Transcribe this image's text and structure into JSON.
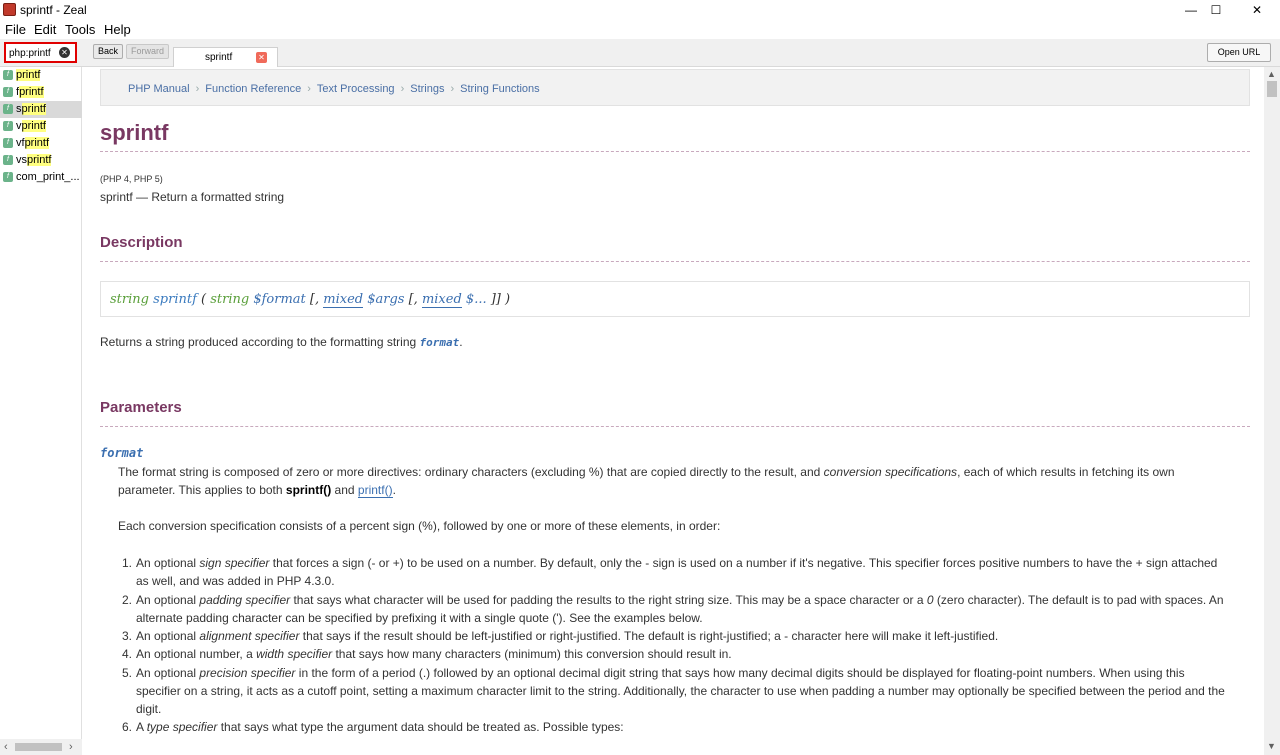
{
  "window": {
    "title": "sprintf - Zeal",
    "minimize": "—",
    "maximize": "☐",
    "close": "✕"
  },
  "menu": {
    "items": [
      "File",
      "Edit",
      "Tools",
      "Help"
    ]
  },
  "toolbar": {
    "search_value": "php:printf",
    "back_label": "Back",
    "forward_label": "Forward",
    "tab_label": "sprintf",
    "open_url_label": "Open URL"
  },
  "sidebar": {
    "results": [
      {
        "highlight": "printf",
        "rest": "",
        "selected": false
      },
      {
        "highlight": "f",
        "rest": "printf",
        "selected": false,
        "swap": true
      },
      {
        "highlight": "s",
        "rest": "printf",
        "selected": true,
        "swap": true
      },
      {
        "highlight": "v",
        "rest": "printf",
        "selected": false,
        "swap": true
      },
      {
        "highlight": "vf",
        "rest": "printf",
        "selected": false,
        "swap": true
      },
      {
        "highlight": "vs",
        "rest": "printf",
        "selected": false,
        "swap": true
      },
      {
        "highlight": "",
        "rest": "com_print_...",
        "selected": false
      }
    ]
  },
  "doc": {
    "breadcrumbs": [
      "PHP Manual",
      "Function Reference",
      "Text Processing",
      "Strings",
      "String Functions"
    ],
    "title": "sprintf",
    "versions": "(PHP 4, PHP 5)",
    "refpurpose": "sprintf — Return a formatted string",
    "description_heading": "Description",
    "synopsis": {
      "type": "string",
      "name": "sprintf",
      "open": " ( ",
      "p1_type": "string",
      "p1_name": "$format",
      "p2_pre": " [, ",
      "p2_type": "mixed",
      "p2_name": "$args",
      "p3_pre": " [, ",
      "p3_type": "mixed",
      "p3_name": "$...",
      "close": " ]] )"
    },
    "returns_text": "Returns a string produced according to the formatting string ",
    "returns_param": "format",
    "returns_end": ".",
    "parameters_heading": "Parameters",
    "param_name": "format",
    "param_desc_1": "The format string is composed of zero or more directives: ordinary characters (excluding %) that are copied directly to the result, and ",
    "param_desc_1_em": "conversion specifications",
    "param_desc_1b": ", each of which results in fetching its own parameter. This applies to both ",
    "param_desc_1_bold": "sprintf()",
    "param_desc_1_and": " and ",
    "param_desc_1_link": "printf()",
    "param_desc_1_end": ".",
    "param_desc_2": "Each conversion specification consists of a percent sign (%), followed by one or more of these elements, in order:",
    "list": [
      {
        "num": "1.",
        "pre": "An optional ",
        "em": "sign specifier",
        "post": " that forces a sign (- or +) to be used on a number. By default, only the - sign is used on a number if it's negative. This specifier forces positive numbers to have the + sign attached as well, and was added in PHP 4.3.0."
      },
      {
        "num": "2.",
        "pre": "An optional ",
        "em": "padding specifier",
        "post": " that says what character will be used for padding the results to the right string size. This may be a space character or a ",
        "em2": "0",
        "post2": " (zero character). The default is to pad with spaces. An alternate padding character can be specified by prefixing it with a single quote ('). See the examples below."
      },
      {
        "num": "3.",
        "pre": "An optional ",
        "em": "alignment specifier",
        "post": " that says if the result should be left-justified or right-justified. The default is right-justified; a - character here will make it left-justified."
      },
      {
        "num": "4.",
        "pre": "An optional number, a ",
        "em": "width specifier",
        "post": " that says how many characters (minimum) this conversion should result in."
      },
      {
        "num": "5.",
        "pre": "An optional ",
        "em": "precision specifier",
        "post": " in the form of a period (.) followed by an optional decimal digit string that says how many decimal digits should be displayed for floating-point numbers. When using this specifier on a string, it acts as a cutoff point, setting a maximum character limit to the string. Additionally, the character to use when padding a number may optionally be specified between the period and the digit."
      },
      {
        "num": "6.",
        "pre": "A ",
        "em": "type specifier",
        "post": " that says what type the argument data should be treated as. Possible types:"
      }
    ]
  },
  "colors": {
    "heading": "#793862",
    "link": "#3b6fb0",
    "search_border": "#e00000",
    "highlight": "#ffff80"
  }
}
